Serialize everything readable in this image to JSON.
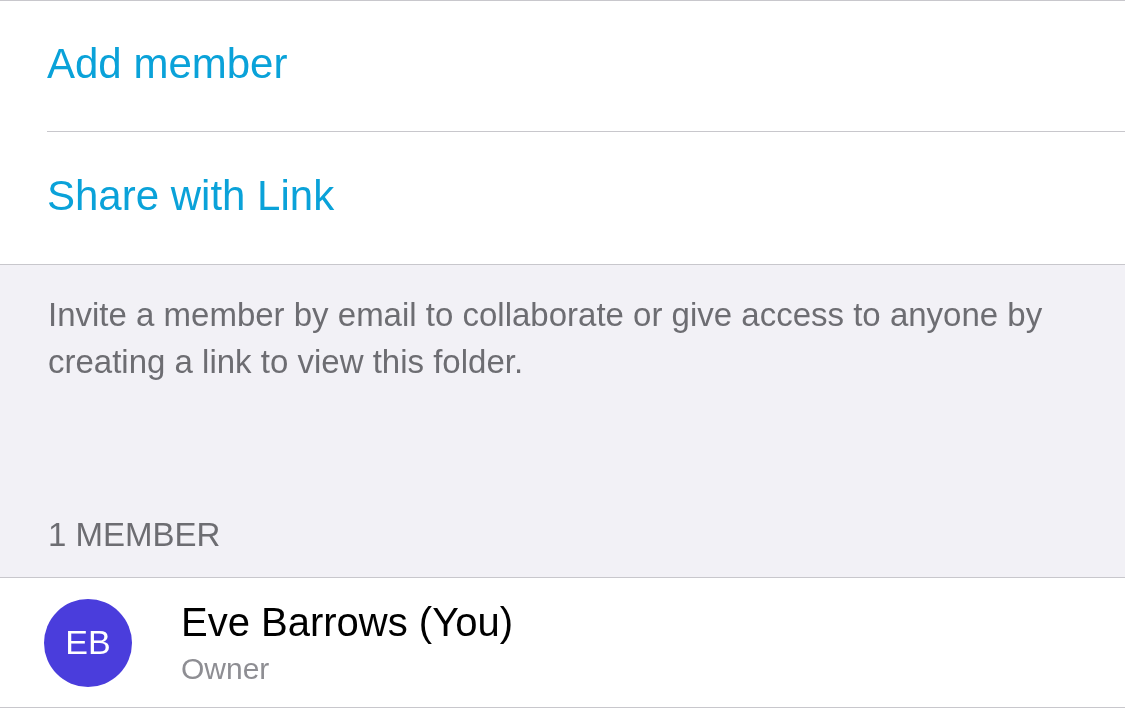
{
  "actions": [
    {
      "label": "Add member"
    },
    {
      "label": "Share with Link"
    }
  ],
  "description": "Invite a member by email to collaborate or give access to anyone by creating a link to view this folder.",
  "members_header": "1 MEMBER",
  "members": [
    {
      "initials": "EB",
      "name": "Eve Barrows (You)",
      "role": "Owner",
      "color": "#4a3ddc"
    }
  ]
}
